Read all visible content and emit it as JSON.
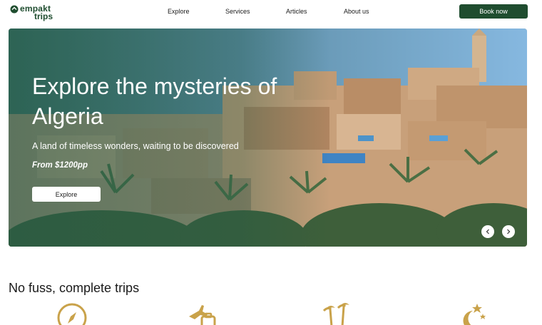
{
  "header": {
    "logo_line1": "empakt",
    "logo_line2": "trips",
    "nav": [
      "Explore",
      "Services",
      "Articles",
      "About us"
    ],
    "book_label": "Book now"
  },
  "hero": {
    "title": "Explore the mysteries of Algeria",
    "subtitle": "A land of timeless wonders, waiting to be discovered",
    "price": "From $1200pp",
    "button_label": "Explore",
    "prev_icon": "chevron-left-icon",
    "next_icon": "chevron-right-icon"
  },
  "section": {
    "title": "No fuss, complete trips",
    "icons": [
      "compass-icon",
      "flight-icon",
      "palm-trees-icon",
      "moon-stars-icon"
    ]
  },
  "colors": {
    "brand_green": "#1f4d2f",
    "icon_gold": "#c9a24a",
    "white": "#ffffff"
  }
}
